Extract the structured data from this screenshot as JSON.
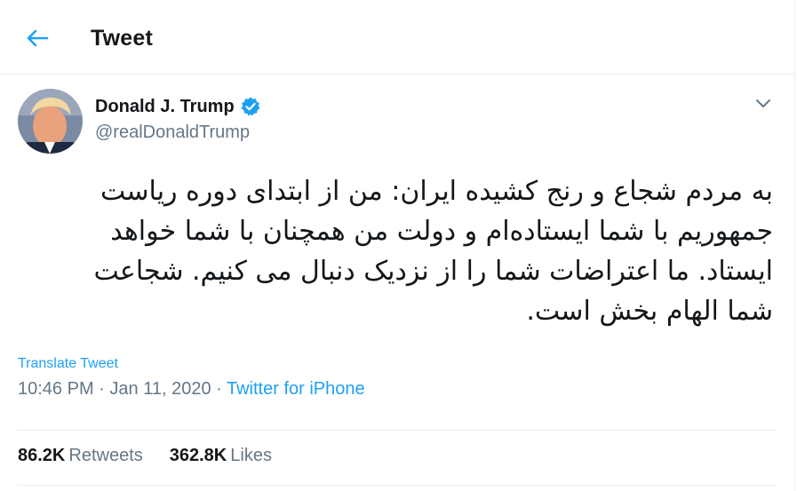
{
  "header": {
    "title": "Tweet",
    "back_icon": "arrow-left-icon"
  },
  "colors": {
    "accent": "#1da1f2",
    "muted": "#657786",
    "text": "#14171a",
    "border": "#e6ecf0"
  },
  "author": {
    "name": "Donald J. Trump",
    "handle": "@realDonaldTrump",
    "verified": true
  },
  "tweet": {
    "lines": [
      "به مردم شجاع و رنج کشیده ایران: من از ابتدای دوره ریاست",
      "جمهوریم با شما ایستاده‌ام و دولت من همچنان با شما خواهد",
      "ایستاد. ما اعتراضات شما را از نزدیک دنبال می کنیم. شجاعت",
      "شما الهام بخش است."
    ],
    "translate_label": "Translate Tweet",
    "time": "10:46 PM",
    "date": "Jan 11, 2020",
    "source": "Twitter for iPhone"
  },
  "stats": {
    "retweets_count": "86.2K",
    "retweets_label": "Retweets",
    "likes_count": "362.8K",
    "likes_label": "Likes"
  }
}
